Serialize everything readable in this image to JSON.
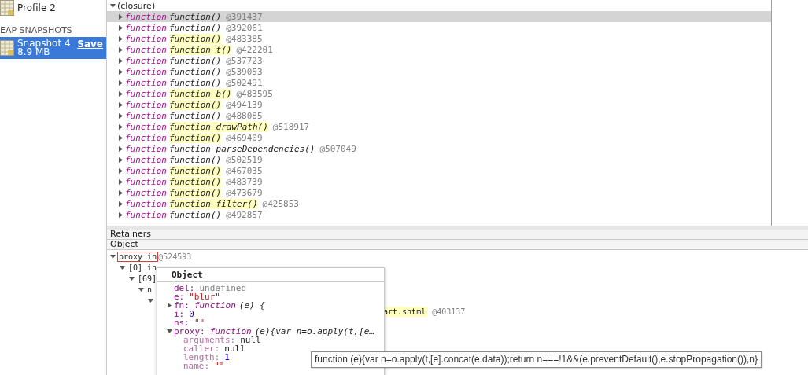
{
  "sidebar": {
    "items": [
      {
        "kind": "profile",
        "label": "Profile 2",
        "selected": false
      },
      {
        "kind": "header",
        "label": "EAP SNAPSHOTS"
      },
      {
        "kind": "snapshot",
        "label": "Snapshot 4",
        "size": "8.9 MB",
        "action": "Save",
        "selected": true
      }
    ]
  },
  "closure": {
    "label": "(closure)",
    "expanded": true,
    "rows": [
      {
        "keyword": "function",
        "name": "function()",
        "id": "@391437",
        "highlighted": false,
        "selected": true
      },
      {
        "keyword": "function",
        "name": "function()",
        "id": "@392061",
        "highlighted": false,
        "selected": false
      },
      {
        "keyword": "function",
        "name": "function()",
        "id": "@483385",
        "highlighted": true,
        "selected": false
      },
      {
        "keyword": "function",
        "name": "function t()",
        "id": "@422201",
        "highlighted": true,
        "selected": false
      },
      {
        "keyword": "function",
        "name": "function()",
        "id": "@537723",
        "highlighted": false,
        "selected": false
      },
      {
        "keyword": "function",
        "name": "function()",
        "id": "@539053",
        "highlighted": false,
        "selected": false
      },
      {
        "keyword": "function",
        "name": "function()",
        "id": "@502491",
        "highlighted": false,
        "selected": false
      },
      {
        "keyword": "function",
        "name": "function b()",
        "id": "@483595",
        "highlighted": true,
        "selected": false
      },
      {
        "keyword": "function",
        "name": "function()",
        "id": "@494139",
        "highlighted": true,
        "selected": false
      },
      {
        "keyword": "function",
        "name": "function()",
        "id": "@488085",
        "highlighted": false,
        "selected": false
      },
      {
        "keyword": "function",
        "name": "function drawPath()",
        "id": "@518917",
        "highlighted": true,
        "selected": false
      },
      {
        "keyword": "function",
        "name": "function()",
        "id": "@469409",
        "highlighted": true,
        "selected": false
      },
      {
        "keyword": "function",
        "name": "function parseDependencies()",
        "id": "@507049",
        "highlighted": false,
        "selected": false
      },
      {
        "keyword": "function",
        "name": "function()",
        "id": "@502519",
        "highlighted": false,
        "selected": false
      },
      {
        "keyword": "function",
        "name": "function()",
        "id": "@467035",
        "highlighted": true,
        "selected": false
      },
      {
        "keyword": "function",
        "name": "function()",
        "id": "@483739",
        "highlighted": true,
        "selected": false
      },
      {
        "keyword": "function",
        "name": "function()",
        "id": "@473679",
        "highlighted": true,
        "selected": false
      },
      {
        "keyword": "function",
        "name": "function filter()",
        "id": "@425853",
        "highlighted": true,
        "selected": false
      },
      {
        "keyword": "function",
        "name": "function()",
        "id": "@492857",
        "highlighted": false,
        "selected": false
      }
    ]
  },
  "retainers": {
    "title": "Retainers",
    "column": "Object",
    "rows": [
      {
        "label": "proxy in",
        "id": "@524593",
        "outlined": true,
        "expanded": true,
        "children": [
          {
            "label": "[0] in",
            "expanded": true,
            "children": [
              {
                "label": "[69]",
                "expanded": true,
                "children": [
                  {
                    "label": "n",
                    "expanded": true,
                    "children": [
                      {
                        "expanded": true,
                        "children": [
                          {
                            "label": "art.shtml",
                            "id": "@403137",
                            "highlighted": true
                          }
                        ]
                      }
                    ]
                  }
                ]
              }
            ]
          }
        ]
      }
    ]
  },
  "popover": {
    "title": "Object",
    "properties": [
      {
        "key": "del:",
        "kind": "undefined",
        "value": "undefined"
      },
      {
        "key": "e:",
        "kind": "string",
        "value": "\"blur\""
      },
      {
        "key": "fn:",
        "kind": "function",
        "value": "function",
        "detail": "(e) {",
        "expanded": false
      },
      {
        "key": "i:",
        "kind": "number",
        "value": "0"
      },
      {
        "key": "ns:",
        "kind": "string",
        "value": "\"\""
      },
      {
        "key": "proxy:",
        "kind": "function",
        "value": "function",
        "detail": "(e){var n=o.apply(t,[e…",
        "expanded": true,
        "children": [
          {
            "key": "arguments:",
            "kind": "null",
            "value": "null"
          },
          {
            "key": "caller:",
            "kind": "null",
            "value": "null"
          },
          {
            "key": "length:",
            "kind": "number",
            "value": "1"
          },
          {
            "key": "name:",
            "kind": "string",
            "value": "\"\""
          }
        ]
      }
    ]
  },
  "tooltip": "function (e){var n=o.apply(t,[e].concat(e.data));return n===!1&&(e.preventDefault(),e.stopPropagation()),n}"
}
